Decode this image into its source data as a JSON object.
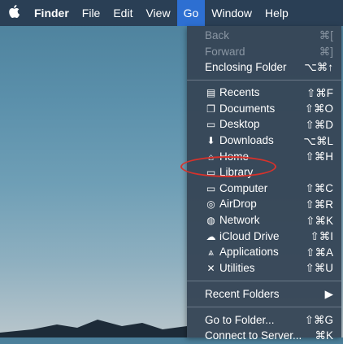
{
  "menubar": {
    "apple": "",
    "items": [
      "Finder",
      "File",
      "Edit",
      "View",
      "Go",
      "Window",
      "Help"
    ]
  },
  "go_menu": {
    "top": [
      {
        "label": "Back",
        "shortcut": "⌘[",
        "enabled": false
      },
      {
        "label": "Forward",
        "shortcut": "⌘]",
        "enabled": false
      },
      {
        "label": "Enclosing Folder",
        "shortcut": "⌥⌘↑",
        "enabled": true
      }
    ],
    "places": [
      {
        "label": "Recents",
        "shortcut": "⇧⌘F",
        "icon": "recents-icon",
        "glyph": "▤"
      },
      {
        "label": "Documents",
        "shortcut": "⇧⌘O",
        "icon": "documents-icon",
        "glyph": "❐"
      },
      {
        "label": "Desktop",
        "shortcut": "⇧⌘D",
        "icon": "desktop-icon",
        "glyph": "▭"
      },
      {
        "label": "Downloads",
        "shortcut": "⌥⌘L",
        "icon": "downloads-icon",
        "glyph": "⬇"
      },
      {
        "label": "Home",
        "shortcut": "⇧⌘H",
        "icon": "home-icon",
        "glyph": "⌂"
      },
      {
        "label": "Library",
        "shortcut": "",
        "icon": "library-folder-icon",
        "glyph": "▭"
      },
      {
        "label": "Computer",
        "shortcut": "⇧⌘C",
        "icon": "computer-icon",
        "glyph": "▭"
      },
      {
        "label": "AirDrop",
        "shortcut": "⇧⌘R",
        "icon": "airdrop-icon",
        "glyph": "◎"
      },
      {
        "label": "Network",
        "shortcut": "⇧⌘K",
        "icon": "network-icon",
        "glyph": "◍"
      },
      {
        "label": "iCloud Drive",
        "shortcut": "⇧⌘I",
        "icon": "icloud-icon",
        "glyph": "☁"
      },
      {
        "label": "Applications",
        "shortcut": "⇧⌘A",
        "icon": "applications-icon",
        "glyph": "⩓"
      },
      {
        "label": "Utilities",
        "shortcut": "⇧⌘U",
        "icon": "utilities-icon",
        "glyph": "✕"
      }
    ],
    "recent_folders": {
      "label": "Recent Folders",
      "arrow": "▶"
    },
    "bottom": [
      {
        "label": "Go to Folder...",
        "shortcut": "⇧⌘G"
      },
      {
        "label": "Connect to Server...",
        "shortcut": "⌘K"
      }
    ]
  },
  "colors": {
    "menubar_bg": "#2a3f55",
    "menu_bg": "#364656",
    "active_menu": "#2d6fd2",
    "highlight_circle": "#d8322b"
  }
}
